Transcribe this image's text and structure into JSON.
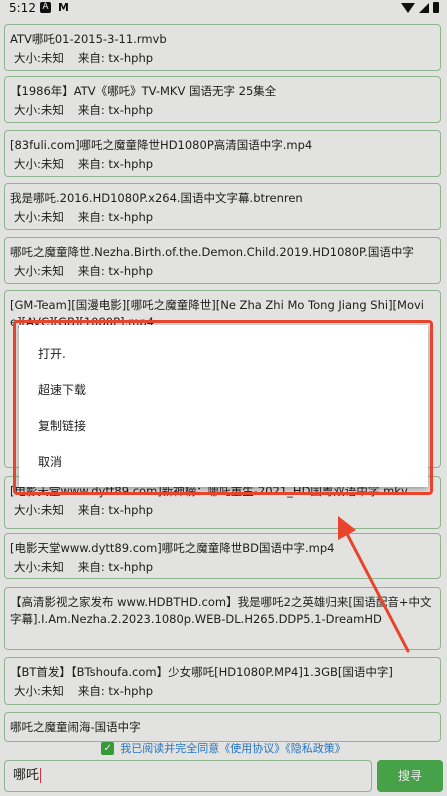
{
  "status_bar": {
    "time": "5:12",
    "icon_a": "A",
    "icon_m": "M"
  },
  "results": [
    {
      "title": "ATV哪吒01-2015-3-11.rmvb",
      "size": "大小:未知",
      "source": "来自:   tx-hphp"
    },
    {
      "title": "【1986年】ATV《哪吒》TV-MKV 国语无字 25集全",
      "size": "大小:未知",
      "source": "来自:   tx-hphp"
    },
    {
      "title": "[83fuli.com]哪吒之魔童降世HD1080P高清国语中字.mp4",
      "size": "大小:未知",
      "source": "来自:   tx-hphp"
    },
    {
      "title": "我是哪吒.2016.HD1080P.x264.国语中文字幕.btrenren",
      "size": "大小:未知",
      "source": "来自:   tx-hphp"
    },
    {
      "title": "哪吒之魔童降世.Nezha.Birth.of.the.Demon.Child.2019.HD1080P.国语中字",
      "size": "大小:未知",
      "source": "来自:   tx-hphp"
    },
    {
      "title": "[GM-Team][国漫电影][哪吒之魔童降世][Ne Zha Zhi Mo Tong Jiang Shi][Movie][AVC][GB][1080P].mp4",
      "size": "",
      "source": ""
    },
    {
      "title": "[电影天堂www.dytt89.com]新神榜：哪吒重生-2021_HD国粤双语中字.mkv",
      "size": "大小:未知",
      "source": "来自:   tx-hphp"
    },
    {
      "title": "[电影天堂www.dytt89.com]哪吒之魔童降世BD国语中字.mp4",
      "size": "大小:未知",
      "source": "来自:   tx-hphp"
    },
    {
      "title": "【高清影视之家发布 www.HDBTHD.com】我是哪吒2之英雄归来[国语配音+中文字幕].I.Am.Nezha.2.2023.1080p.WEB-DL.H265.DDP5.1-DreamHD",
      "size": "",
      "source": ""
    },
    {
      "title": "【BT首发】【BTshoufa.com】少女哪吒[HD1080P.MP4]1.3GB[国语中字]",
      "size": "大小:未知",
      "source": "来自:   tx-hphp"
    },
    {
      "title": "哪吒之魔童闹海-国语中字",
      "size": "",
      "source": ""
    }
  ],
  "dialog": {
    "items": [
      "打开.",
      "超速下载",
      "复制链接",
      "取消"
    ]
  },
  "agreement": {
    "text": "我已阅读并完全同意《使用协议》《隐私政策》"
  },
  "search": {
    "value": "哪吒",
    "button_label": "搜寻"
  },
  "colors": {
    "accent": "#4caf50",
    "annotation": "#e8442c",
    "link": "#2a7fd0"
  }
}
